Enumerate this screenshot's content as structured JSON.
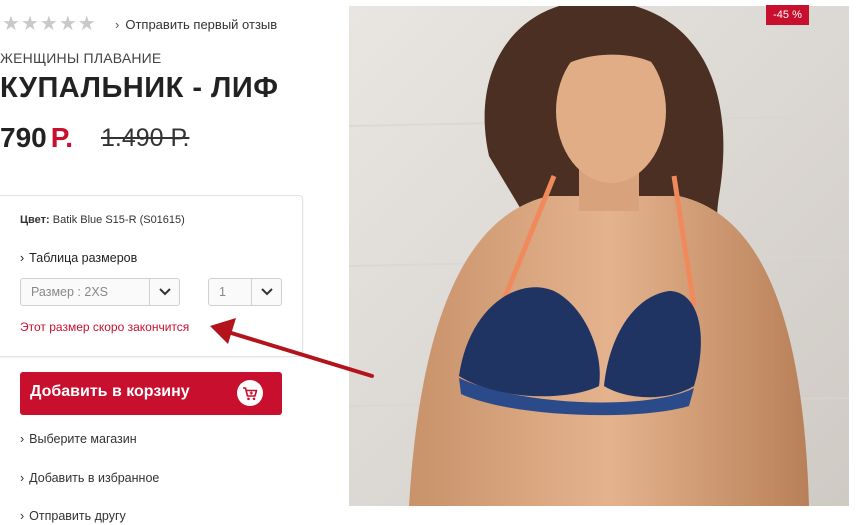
{
  "rating": {
    "stars": 5,
    "filled": 0,
    "review_link": "Отправить первый отзыв"
  },
  "product": {
    "category": "ЖЕНЩИНЫ ПЛАВАНИЕ",
    "title": "КУПАЛЬНИК - ЛИФ",
    "price": "790",
    "currency": "Р.",
    "old_price": "1.490 Р.",
    "discount_badge": "-45 %"
  },
  "options": {
    "color_label": "Цвет:",
    "color_value": "Batik Blue S15-R (S01615)",
    "size_table_link": "Таблица размеров",
    "size_select_value": "Размер : 2XS",
    "qty_select_value": "1",
    "stock_warning": "Этот размер скоро закончится"
  },
  "actions": {
    "add_to_cart": "Добавить в корзину",
    "choose_store": "Выберите магазин",
    "add_to_favorites": "Добавить в избранное",
    "send_to_friend": "Отправить другу"
  },
  "colors": {
    "accent": "#c8102e",
    "arrow": "#b3141c",
    "star_empty": "#c9c9c9"
  },
  "icons": [
    "star-icon",
    "chevron-right-icon",
    "chevron-down-icon",
    "cart-icon"
  ]
}
